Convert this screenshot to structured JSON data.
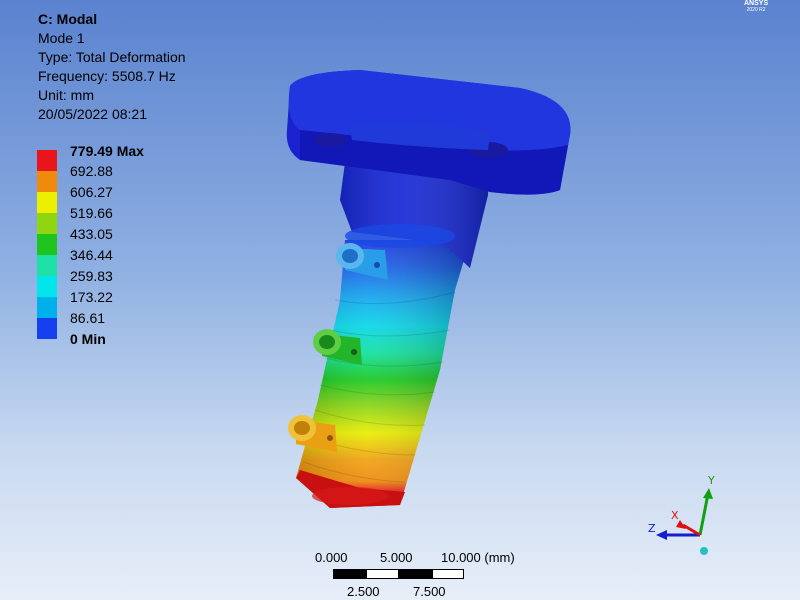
{
  "info": {
    "title": "C: Modal",
    "mode": "Mode 1",
    "type": "Type: Total Deformation",
    "frequency": "Frequency: 5508.7 Hz",
    "unit": "Unit: mm",
    "timestamp": "20/05/2022 08:21"
  },
  "legend": {
    "entries": [
      {
        "label": "779.49 Max",
        "color": "#e8151b"
      },
      {
        "label": "692.88",
        "color": "#f08a0c"
      },
      {
        "label": "606.27",
        "color": "#ecf000"
      },
      {
        "label": "519.66",
        "color": "#8fd611"
      },
      {
        "label": "433.05",
        "color": "#1fc51f"
      },
      {
        "label": "346.44",
        "color": "#1fe0a6"
      },
      {
        "label": "259.83",
        "color": "#00e6ea"
      },
      {
        "label": "173.22",
        "color": "#00b0ec"
      },
      {
        "label": "86.61",
        "color": "#1540f0"
      },
      {
        "label": "0 Min",
        "color": "#1010d8"
      }
    ]
  },
  "logo": {
    "brand": "ANSYS",
    "version": "2020 R2"
  },
  "scale_bar": {
    "top_labels": [
      "0.000",
      "5.000",
      "10.000 (mm)"
    ],
    "bottom_labels": [
      "2.500",
      "7.500"
    ]
  },
  "triad": {
    "x_label": "X",
    "y_label": "Y",
    "z_label": "Z",
    "x_color": "#e01010",
    "y_color": "#10a010",
    "z_color": "#1020d0"
  }
}
